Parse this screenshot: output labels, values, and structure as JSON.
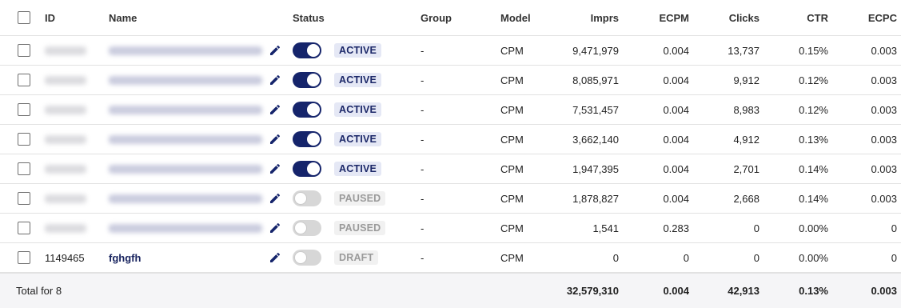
{
  "colors": {
    "accent": "#15246b",
    "active_badge_bg": "#e5e8f5",
    "inactive_badge_bg": "#f1f1f1",
    "total_row_bg": "#f5f5f7"
  },
  "columns": {
    "id": "ID",
    "name": "Name",
    "status": "Status",
    "group": "Group",
    "model": "Model",
    "imprs": "Imprs",
    "ecpm": "ECPM",
    "clicks": "Clicks",
    "ctr": "CTR",
    "ecpc": "ECPC"
  },
  "rows": [
    {
      "id": "",
      "name": "",
      "enabled": true,
      "status": "ACTIVE",
      "group": "-",
      "model": "CPM",
      "imprs": "9,471,979",
      "ecpm": "0.004",
      "clicks": "13,737",
      "ctr": "0.15%",
      "ecpc": "0.003"
    },
    {
      "id": "",
      "name": "",
      "enabled": true,
      "status": "ACTIVE",
      "group": "-",
      "model": "CPM",
      "imprs": "8,085,971",
      "ecpm": "0.004",
      "clicks": "9,912",
      "ctr": "0.12%",
      "ecpc": "0.003"
    },
    {
      "id": "",
      "name": "",
      "enabled": true,
      "status": "ACTIVE",
      "group": "-",
      "model": "CPM",
      "imprs": "7,531,457",
      "ecpm": "0.004",
      "clicks": "8,983",
      "ctr": "0.12%",
      "ecpc": "0.003"
    },
    {
      "id": "",
      "name": "",
      "enabled": true,
      "status": "ACTIVE",
      "group": "-",
      "model": "CPM",
      "imprs": "3,662,140",
      "ecpm": "0.004",
      "clicks": "4,912",
      "ctr": "0.13%",
      "ecpc": "0.003"
    },
    {
      "id": "",
      "name": "",
      "enabled": true,
      "status": "ACTIVE",
      "group": "-",
      "model": "CPM",
      "imprs": "1,947,395",
      "ecpm": "0.004",
      "clicks": "2,701",
      "ctr": "0.14%",
      "ecpc": "0.003"
    },
    {
      "id": "",
      "name": "",
      "enabled": false,
      "status": "PAUSED",
      "group": "-",
      "model": "CPM",
      "imprs": "1,878,827",
      "ecpm": "0.004",
      "clicks": "2,668",
      "ctr": "0.14%",
      "ecpc": "0.003"
    },
    {
      "id": "",
      "name": "",
      "enabled": false,
      "status": "PAUSED",
      "group": "-",
      "model": "CPM",
      "imprs": "1,541",
      "ecpm": "0.283",
      "clicks": "0",
      "ctr": "0.00%",
      "ecpc": "0"
    },
    {
      "id": "1149465",
      "name": "fghgfh",
      "enabled": false,
      "status": "DRAFT",
      "group": "-",
      "model": "CPM",
      "imprs": "0",
      "ecpm": "0",
      "clicks": "0",
      "ctr": "0.00%",
      "ecpc": "0"
    }
  ],
  "total": {
    "label": "Total for 8",
    "imprs": "32,579,310",
    "ecpm": "0.004",
    "clicks": "42,913",
    "ctr": "0.13%",
    "ecpc": "0.003"
  }
}
